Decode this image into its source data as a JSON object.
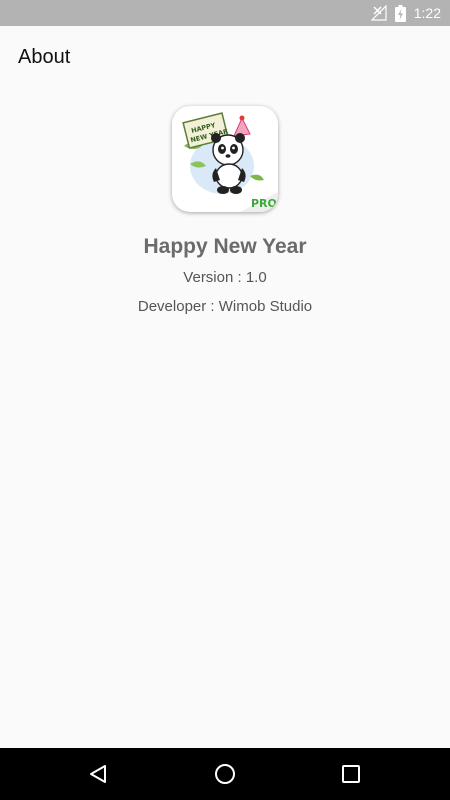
{
  "status_bar": {
    "time": "1:22",
    "icons": [
      "no-signal-icon",
      "battery-charging-icon"
    ]
  },
  "toolbar": {
    "title": "About"
  },
  "app": {
    "icon_name": "panda-app-icon",
    "icon_sign_text": "HAPPY NEW YEAR",
    "icon_badge": "PRO",
    "name": "Happy New Year",
    "version_text": "Version : 1.0",
    "developer_text": "Developer : Wimob Studio"
  },
  "nav_bar": {
    "buttons": [
      "back-icon",
      "home-icon",
      "recent-apps-icon"
    ]
  },
  "colors": {
    "status_bar_bg": "#b3b3b3",
    "background": "#fafafa",
    "app_name": "#6b6b6b",
    "badge_green": "#3aaa35",
    "nav_bar_bg": "#000000"
  }
}
